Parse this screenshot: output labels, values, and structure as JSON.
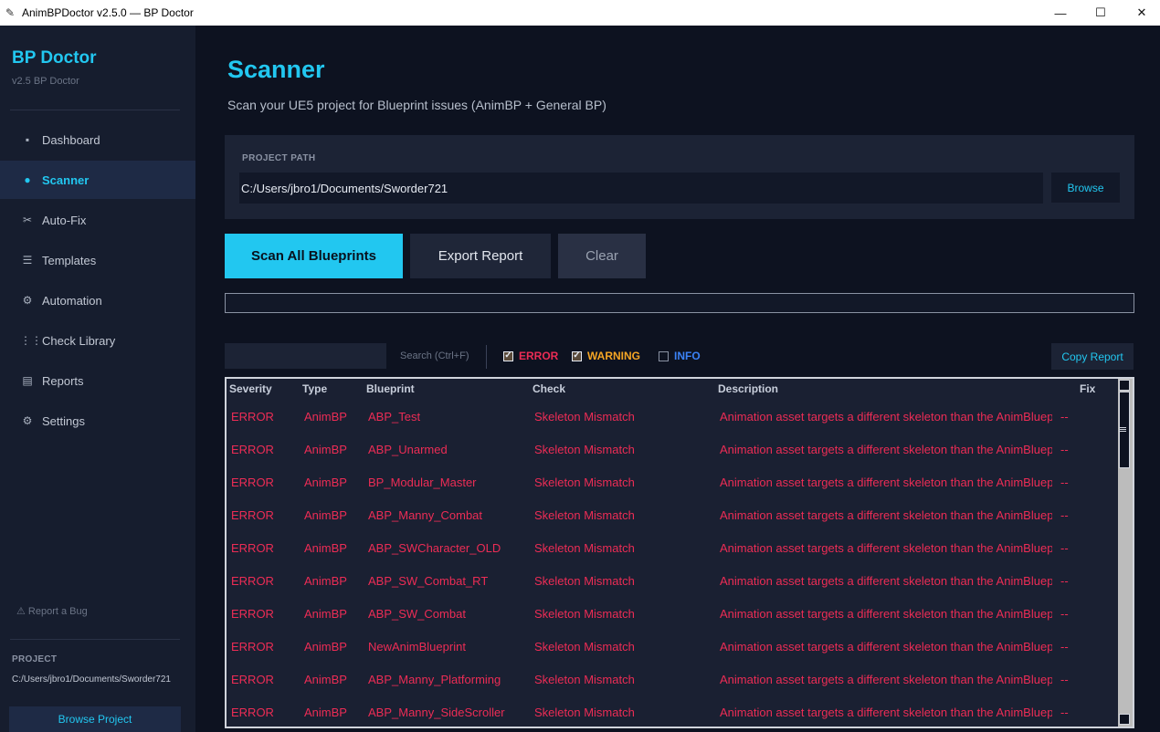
{
  "window": {
    "title": "AnimBPDoctor v2.5.0 — BP Doctor",
    "minimize": "—",
    "maximize": "☐",
    "close": "✕"
  },
  "sidebar": {
    "brand": "BP Doctor",
    "version": "v2.5  BP Doctor",
    "items": [
      {
        "label": "Dashboard",
        "icon": "▪"
      },
      {
        "label": "Scanner",
        "icon": "●"
      },
      {
        "label": "Auto-Fix",
        "icon": "✂"
      },
      {
        "label": "Templates",
        "icon": "☰"
      },
      {
        "label": "Automation",
        "icon": "⚙"
      },
      {
        "label": "Check Library",
        "icon": "⋮⋮"
      },
      {
        "label": "Reports",
        "icon": "▤"
      },
      {
        "label": "Settings",
        "icon": "⚙"
      }
    ],
    "active": "Scanner",
    "report_bug": "⚠  Report a Bug",
    "project_label": "PROJECT",
    "project_path": "C:/Users/jbro1/Documents/Sworder721",
    "browse_project": "Browse Project"
  },
  "main": {
    "title": "Scanner",
    "subtitle": "Scan your UE5 project for Blueprint issues (AnimBP + General BP)",
    "path_label": "PROJECT PATH",
    "path_value": "C:/Users/jbro1/Documents/Sworder721",
    "browse": "Browse",
    "scan_all": "Scan All Blueprints",
    "export_report": "Export Report",
    "clear": "Clear",
    "progress": 0,
    "search_value": "",
    "search_hint": "Search (Ctrl+F)",
    "filters": {
      "error": {
        "label": "ERROR",
        "checked": true,
        "color": "#ec2c55"
      },
      "warning": {
        "label": "WARNING",
        "checked": true,
        "color": "#f5a524"
      },
      "info": {
        "label": "INFO",
        "checked": false,
        "color": "#3b82f6"
      }
    },
    "copy_report": "Copy Report"
  },
  "table": {
    "columns": [
      "Severity",
      "Type",
      "Blueprint",
      "Check",
      "Description",
      "Fix"
    ],
    "rows": [
      [
        "ERROR",
        "AnimBP",
        "ABP_Test",
        "Skeleton Mismatch",
        "Animation asset targets a different skeleton than the AnimBlueprint",
        "--"
      ],
      [
        "ERROR",
        "AnimBP",
        "ABP_Unarmed",
        "Skeleton Mismatch",
        "Animation asset targets a different skeleton than the AnimBlueprint",
        "--"
      ],
      [
        "ERROR",
        "AnimBP",
        "BP_Modular_Master",
        "Skeleton Mismatch",
        "Animation asset targets a different skeleton than the AnimBlueprint",
        "--"
      ],
      [
        "ERROR",
        "AnimBP",
        "ABP_Manny_Combat",
        "Skeleton Mismatch",
        "Animation asset targets a different skeleton than the AnimBlueprint",
        "--"
      ],
      [
        "ERROR",
        "AnimBP",
        "ABP_SWCharacter_OLD",
        "Skeleton Mismatch",
        "Animation asset targets a different skeleton than the AnimBlueprint",
        "--"
      ],
      [
        "ERROR",
        "AnimBP",
        "ABP_SW_Combat_RT",
        "Skeleton Mismatch",
        "Animation asset targets a different skeleton than the AnimBlueprint",
        "--"
      ],
      [
        "ERROR",
        "AnimBP",
        "ABP_SW_Combat",
        "Skeleton Mismatch",
        "Animation asset targets a different skeleton than the AnimBlueprint",
        "--"
      ],
      [
        "ERROR",
        "AnimBP",
        "NewAnimBlueprint",
        "Skeleton Mismatch",
        "Animation asset targets a different skeleton than the AnimBlueprint",
        "--"
      ],
      [
        "ERROR",
        "AnimBP",
        "ABP_Manny_Platforming",
        "Skeleton Mismatch",
        "Animation asset targets a different skeleton than the AnimBlueprint",
        "--"
      ],
      [
        "ERROR",
        "AnimBP",
        "ABP_Manny_SideScroller",
        "Skeleton Mismatch",
        "Animation asset targets a different skeleton than the AnimBlueprint",
        "--"
      ]
    ]
  }
}
